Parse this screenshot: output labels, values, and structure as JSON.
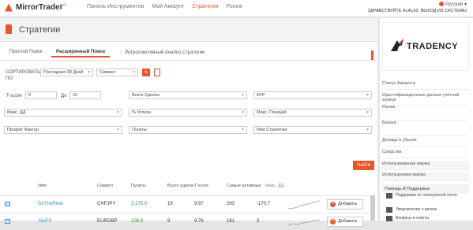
{
  "brand": {
    "name": "MirrorTrader",
    "badge": "beta"
  },
  "nav": {
    "items": [
      "Панель Инструментов",
      "Мой Аккаунт",
      "Стратегии",
      "Рынок"
    ],
    "active": 2
  },
  "lang": {
    "label": "Русский ▾"
  },
  "welcome": "ЗДРАВСТВУЙТЕ ALAL50, ВЫХОД ИЗ СИСТЕМЫ",
  "page": {
    "title": "Стратегии"
  },
  "tabs": [
    "Простой Поиск",
    "Расширенный Поиск",
    "Ретроспективный Анализ Стратегии"
  ],
  "sort": {
    "label": "СОРТИРОВАТЬ ПО",
    "period": "Последние 30 Дней",
    "field": "Символ"
  },
  "filters": {
    "tscore_label": "T-score",
    "tscore_from": "0",
    "to_label": "До",
    "tscore_to": "10",
    "total_trades": "Всего Сделок",
    "kpp": "КРР",
    "max_dd": "Макс. ДД",
    "success": "% Успеха",
    "max_positions": "Макс. Позиций",
    "profit_factor": "Профит Фактор",
    "points": "Пункты",
    "strategy_name": "Имя Стратегии"
  },
  "find_label": "Найти",
  "table": {
    "headers": [
      "Имя",
      "Символ",
      "Пункты",
      "Всего сделок",
      "T-score",
      "Самые активные",
      "Мин. Вложения"
    ],
    "header_extra": "Макс. ДД",
    "rows": [
      {
        "name": "OnTheRiver",
        "symbol": "CHFJPY",
        "points": "3,175.0",
        "trades": "19",
        "tscore": "9.97",
        "active": "263",
        "min": "-170.7",
        "add": "Добавить"
      },
      {
        "name": "YesFX",
        "symbol": "EURGBP",
        "points": "108.9",
        "trades": "9",
        "tscore": "9.76",
        "active": "161",
        "min": "0",
        "add": "Добавить"
      }
    ]
  },
  "side": {
    "ad_text": "TRADENCY",
    "items": [
      "Статус Аккаунта",
      "Идентификационные данные учётной записи",
      "Рынок",
      "Баланс",
      "Доходы и убытки",
      "Средства",
      "Использованная маржа",
      "Используемая маржа"
    ],
    "support_title": "Помощь И Поддержка",
    "support_items": [
      "Поддержка по электронной почте",
      "Уведомление о рисках",
      "Вопросы и ответы"
    ]
  },
  "colors": {
    "accent": "#e8542c",
    "link": "#2a8fd0"
  }
}
